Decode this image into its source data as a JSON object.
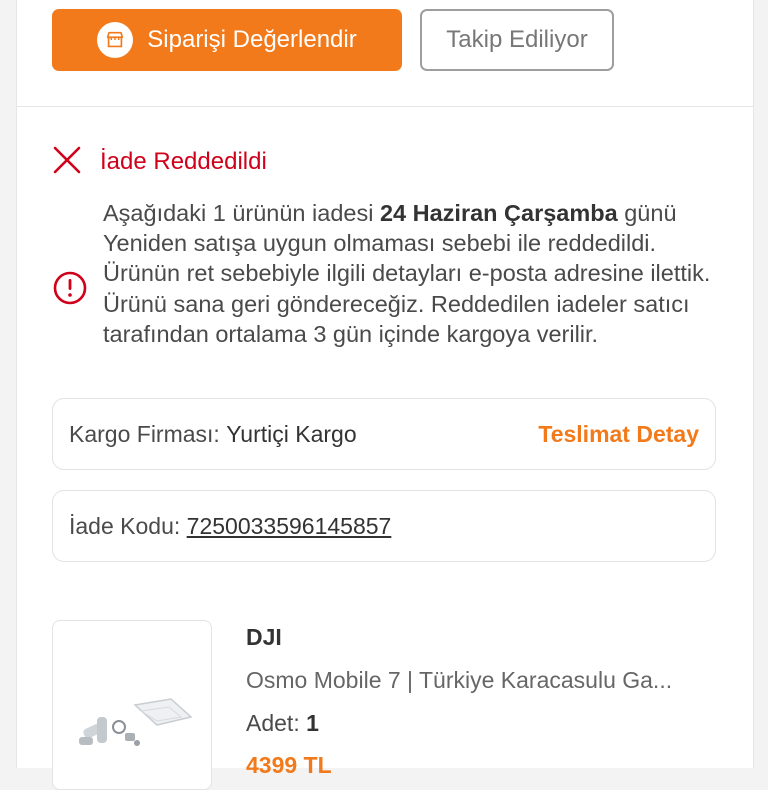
{
  "actions": {
    "rate_order_label": "Siparişi Değerlendir",
    "following_label": "Takip Ediliyor"
  },
  "return_status": {
    "title": "İade Reddedildi",
    "message_prefix": "Aşağıdaki 1 ürünün iadesi ",
    "message_date": "24 Haziran Çarşamba",
    "message_suffix": " günü Yeniden satışa uygun olmaması sebebi ile reddedildi. Ürünün ret sebebiyle ilgili detayları e-posta adresine ilettik. Ürünü sana geri göndereceğiz. Reddedilen iadeler satıcı tarafından ortalama 3 gün içinde kargoya verilir."
  },
  "shipping": {
    "carrier_label": "Kargo Firması:",
    "carrier_value": "Yurtiçi Kargo",
    "delivery_detail_link": "Teslimat Detay"
  },
  "return_code": {
    "label": "İade Kodu:",
    "value": "7250033596145857"
  },
  "product": {
    "brand": "DJI",
    "name": "Osmo Mobile 7 | Türkiye Karacasulu Ga...",
    "qty_label": "Adet:",
    "qty_value": "1",
    "price": "4399 TL"
  },
  "colors": {
    "accent": "#f27a1a",
    "error": "#d0021b"
  },
  "icons": {
    "rate": "store-icon",
    "status": "close-x-icon",
    "info": "info-circle-icon"
  }
}
